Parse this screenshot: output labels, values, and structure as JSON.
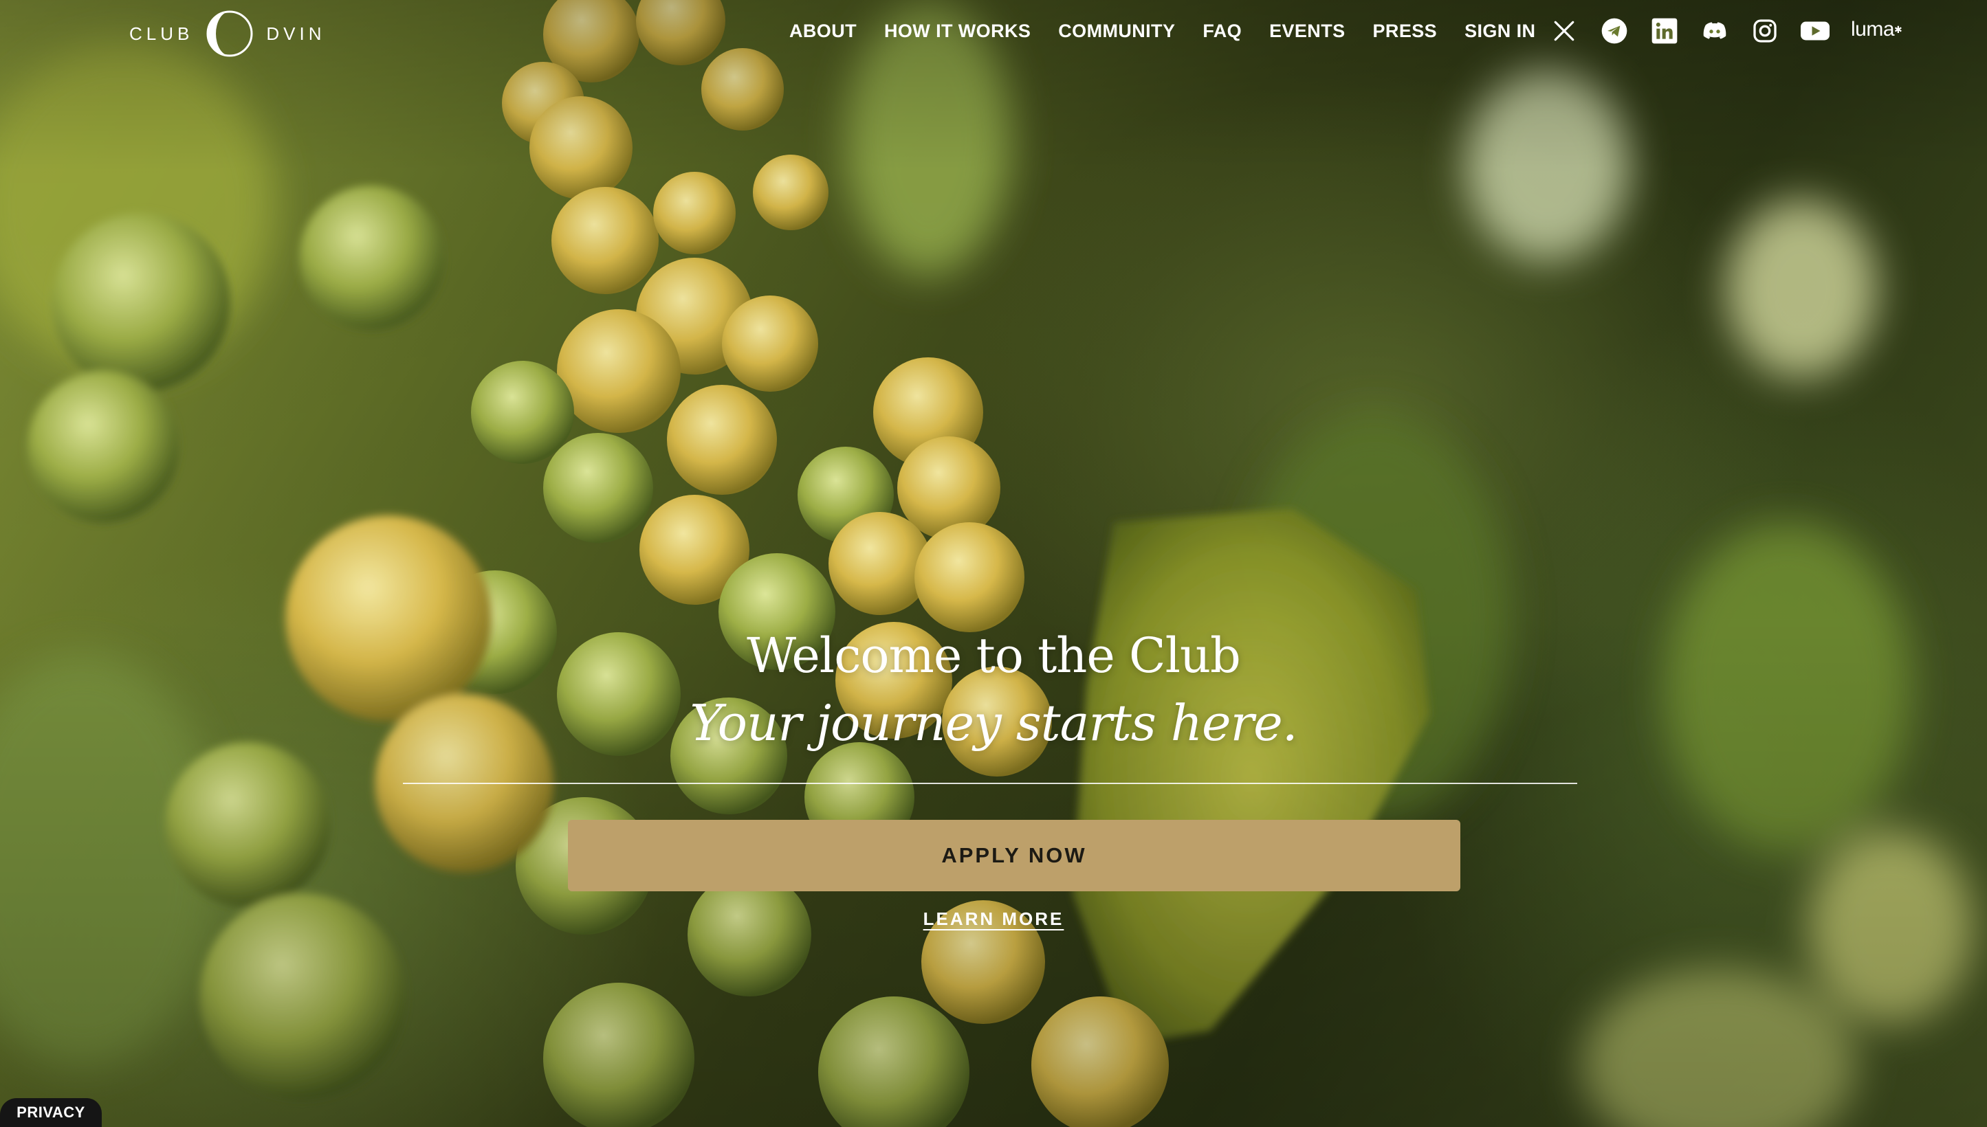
{
  "brand": {
    "left_word": "CLUB",
    "right_word": "DVIN"
  },
  "nav": {
    "items": [
      "ABOUT",
      "HOW IT WORKS",
      "COMMUNITY",
      "FAQ",
      "EVENTS",
      "PRESS",
      "SIGN IN"
    ]
  },
  "social": {
    "icons": [
      "x-icon",
      "telegram-icon",
      "linkedin-icon",
      "discord-icon",
      "instagram-icon",
      "youtube-icon"
    ],
    "luma_label": "luma"
  },
  "hero": {
    "title": "Welcome to the Club",
    "subtitle": "Your journey starts here.",
    "apply_label": "APPLY NOW",
    "learn_more_label": "LEARN MORE"
  },
  "footer": {
    "privacy_label": "PRIVACY"
  },
  "colors": {
    "button": "#bda06a",
    "text": "#ffffff"
  }
}
